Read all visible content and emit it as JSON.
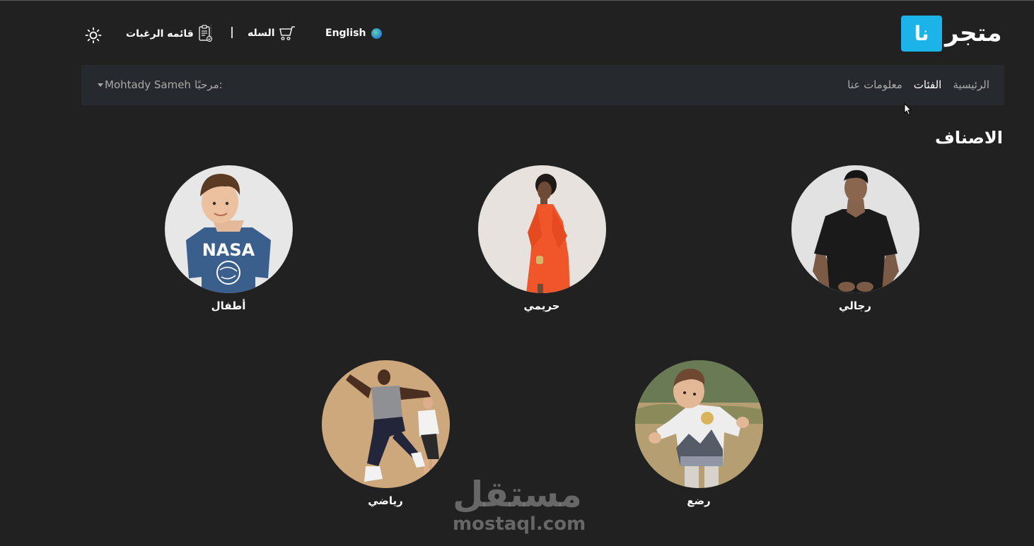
{
  "brand": {
    "name": "متجر",
    "badge": "نا",
    "badge_color": "#1bb3e8"
  },
  "header": {
    "language": "English",
    "language_icon": "globe-icon",
    "cart_label": "السله",
    "cart_icon": "cart-icon",
    "wishlist_label": "قائمه الرغبات",
    "wishlist_icon": "clipboard-icon",
    "theme_icon": "sun-icon"
  },
  "nav": {
    "links": [
      {
        "label": "الرئيسية",
        "active": false
      },
      {
        "label": "الفئات",
        "active": true
      },
      {
        "label": "معلومات عنا",
        "active": false
      }
    ],
    "greeting_prefix": "مرحبًا:",
    "user_name": "Mohtady Sameh"
  },
  "categories": {
    "title": "الاصناف",
    "items": [
      {
        "label": "رجالي",
        "image": "man in black t-shirt"
      },
      {
        "label": "حريمي",
        "image": "woman in orange dress"
      },
      {
        "label": "أطفال",
        "image": "boy in NASA t-shirt"
      },
      {
        "label": "رضع",
        "image": "baby in knit sweater"
      },
      {
        "label": "رياضي",
        "image": "two men exercising"
      }
    ]
  },
  "kids_shirt_text": "NASA",
  "watermark": {
    "arabic": "مستقل",
    "latin": "mostaql.com"
  }
}
